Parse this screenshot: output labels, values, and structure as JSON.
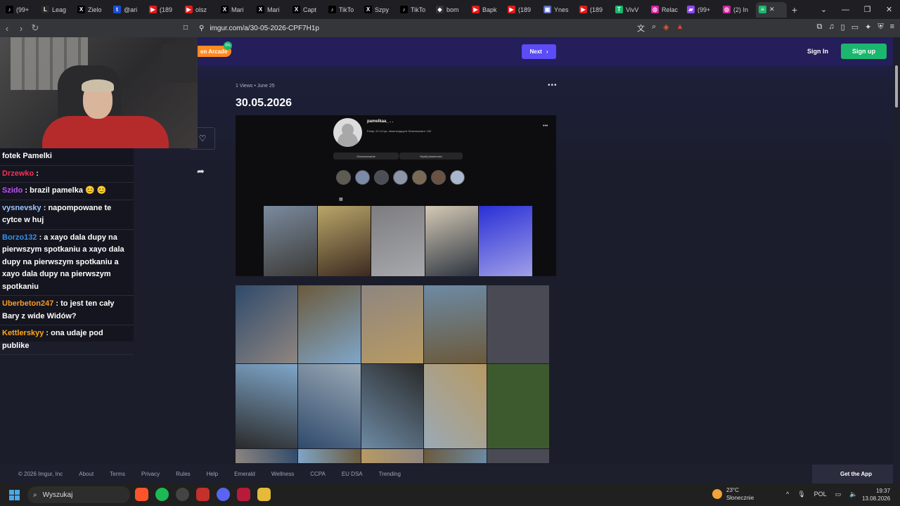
{
  "browser": {
    "tabs": [
      {
        "label": "(99+",
        "color": "#000000",
        "glyph": "♪"
      },
      {
        "label": "Leag",
        "color": "#2a2a2a",
        "glyph": "L"
      },
      {
        "label": "Zielo",
        "color": "#000000",
        "glyph": "X"
      },
      {
        "label": "@ari",
        "color": "#1a4fd6",
        "glyph": "t"
      },
      {
        "label": "(189",
        "color": "#e01b1b",
        "glyph": "▶"
      },
      {
        "label": "olsz",
        "color": "#e01b1b",
        "glyph": "▶"
      },
      {
        "label": "Mari",
        "color": "#000000",
        "glyph": "X"
      },
      {
        "label": "Mari",
        "color": "#000000",
        "glyph": "X"
      },
      {
        "label": "Capt",
        "color": "#000000",
        "glyph": "X"
      },
      {
        "label": "TikTo",
        "color": "#000000",
        "glyph": "♪"
      },
      {
        "label": "Szpy",
        "color": "#000000",
        "glyph": "X"
      },
      {
        "label": "TikTo",
        "color": "#000000",
        "glyph": "♪"
      },
      {
        "label": "bom",
        "color": "#333333",
        "glyph": "◆"
      },
      {
        "label": "Bapk",
        "color": "#e01b1b",
        "glyph": "▶"
      },
      {
        "label": "(189",
        "color": "#e01b1b",
        "glyph": "▶"
      },
      {
        "label": "Ynes",
        "color": "#5c6bc0",
        "glyph": "▣"
      },
      {
        "label": "(189",
        "color": "#e01b1b",
        "glyph": "▶"
      },
      {
        "label": "VivV",
        "color": "#1bb76e",
        "glyph": "T"
      },
      {
        "label": "Relac",
        "color": "#d6249f",
        "glyph": "◎"
      },
      {
        "label": "(99+",
        "color": "#9146ff",
        "glyph": "▰"
      },
      {
        "label": "(2) In",
        "color": "#d6249f",
        "glyph": "◎"
      }
    ],
    "active_tab_label": "",
    "url": "imgur.com/a/30-05-2026-CPF7H1p"
  },
  "header": {
    "arcade_label": "en Arcade",
    "arcade_badge": "5%",
    "next_label": "Next",
    "signin_label": "Sign In",
    "signup_label": "Sign up"
  },
  "post": {
    "meta": "1 Views • June 25",
    "title": "30.05.2026",
    "profile_name": "pamelkaa_ . .",
    "profile_stats": "Posty: 22   14 tys. obserwujących   Obserwowani: 132",
    "follow_button": "Obserwowanie",
    "message_button": "Wyślij wiadomość"
  },
  "chat": {
    "messages": [
      {
        "user": "",
        "color": "#ffffff",
        "text": "fotek Pamelki"
      },
      {
        "user": "Drzewko",
        "color": "#ff2b55",
        "text": " : "
      },
      {
        "user": "Szido",
        "color": "#c250ff",
        "text": " : brazil pamelka 😊 😊"
      },
      {
        "user": "vysnevsky",
        "color": "#9bc6ff",
        "text": " : napompowane te cytce w huj"
      },
      {
        "user": "Borzo132",
        "color": "#3b8fe8",
        "text": " : a xayo dala dupy na pierwszym spotkaniu  a xayo dala dupy na pierwszym spotkaniu  a xayo dala dupy na pierwszym spotkaniu"
      },
      {
        "user": "Uberbeton247",
        "color": "#ff9a1f",
        "text": " : to jest ten cały Bary z wide Widów?"
      },
      {
        "user": "Kettlerskyy",
        "color": "#ffa81f",
        "text": " : ona udaje pod publike"
      }
    ]
  },
  "footer": {
    "copyright": "© 2026 Imgur, Inc",
    "links": [
      "About",
      "Terms",
      "Privacy",
      "Rules",
      "Help",
      "Emerald",
      "Wellness",
      "CCPA",
      "EU DSA",
      "Trending"
    ],
    "get_app": "Get the App"
  },
  "taskbar": {
    "search_placeholder": "Wyszukaj",
    "temperature": "23°C",
    "weather": "Słonecznie",
    "language": "POL",
    "time": "19:37",
    "date": "13.08.2026"
  },
  "photo_colors": [
    "#2f4a6b",
    "#6b5a3c",
    "#8f8680",
    "#6d8aa4",
    "#4a4a55",
    "#7fa6c9",
    "#9aa9b6",
    "#2a2a2a",
    "#b79a63",
    "#3d5a2f"
  ]
}
